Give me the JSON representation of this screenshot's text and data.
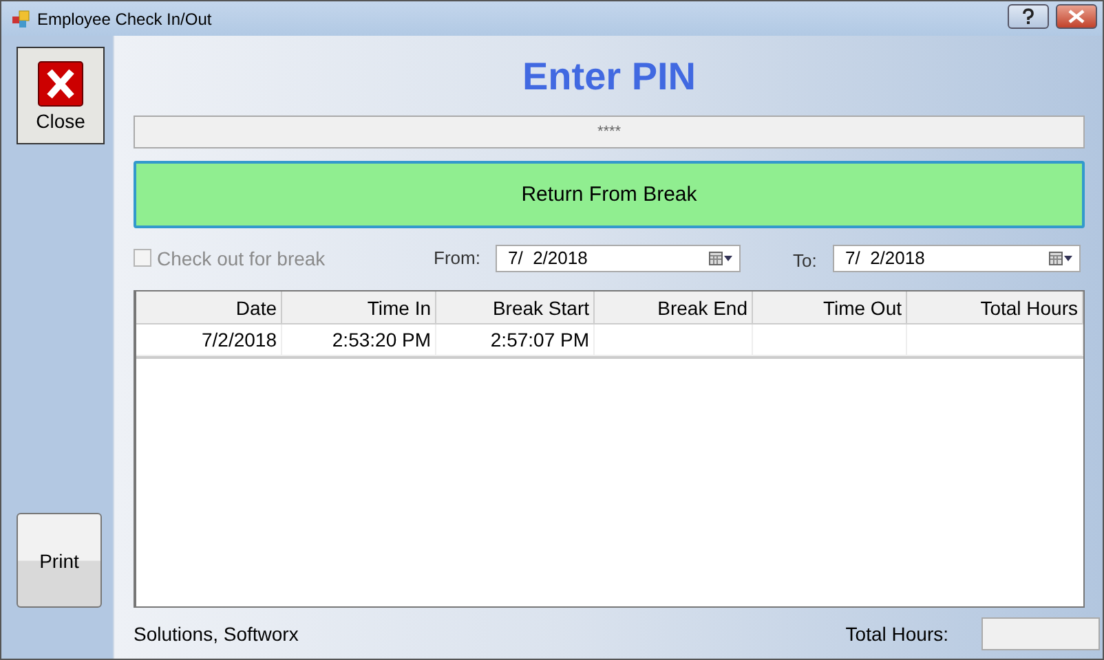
{
  "window": {
    "title": "Employee Check In/Out"
  },
  "close_button": {
    "label": "Close"
  },
  "print_button": {
    "label": "Print"
  },
  "heading": "Enter PIN",
  "pin_field": {
    "value": "****"
  },
  "action_button": {
    "label": "Return From Break"
  },
  "break_checkbox": {
    "label": "Check out for break",
    "checked": false,
    "disabled": true
  },
  "from": {
    "label": "From:",
    "value": "7/  2/2018"
  },
  "to": {
    "label": "To:",
    "value": "7/  2/2018"
  },
  "table": {
    "columns": [
      "Date",
      "Time In",
      "Break Start",
      "Break End",
      "Time Out",
      "Total Hours"
    ],
    "rows": [
      [
        "7/2/2018",
        "2:53:20 PM",
        "2:57:07 PM",
        "",
        "",
        ""
      ]
    ]
  },
  "status_bar": {
    "company": "Solutions, Softworx",
    "total_label": "Total Hours:"
  }
}
